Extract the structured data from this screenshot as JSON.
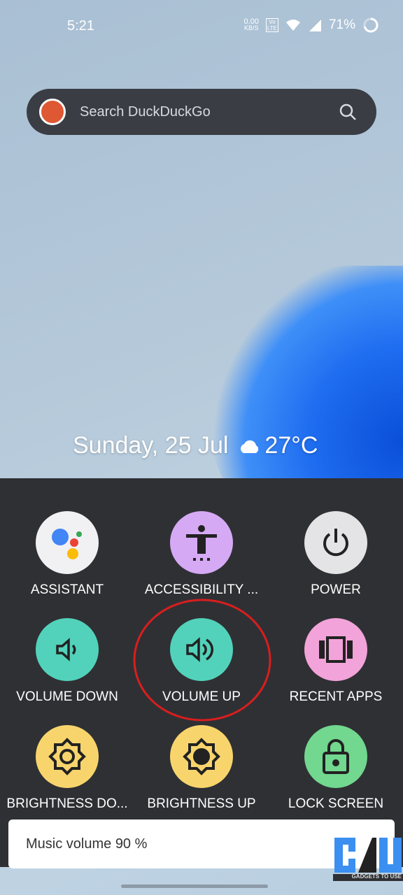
{
  "status": {
    "time": "5:21",
    "net_speed": "0.00",
    "net_unit": "KB/S",
    "volte": "Vo LTE",
    "battery": "71%"
  },
  "search": {
    "placeholder": "Search DuckDuckGo"
  },
  "date_widget": {
    "date": "Sunday, 25 Jul",
    "weather_icon": "cloud-icon",
    "temp": "27°C"
  },
  "menu": {
    "items": [
      {
        "label": "ASSISTANT",
        "icon": "assistant-icon",
        "color": "#f1f1f3"
      },
      {
        "label": "ACCESSIBILITY ...",
        "icon": "accessibility-icon",
        "color": "#d6a9f4"
      },
      {
        "label": "POWER",
        "icon": "power-icon",
        "color": "#e4e4e7"
      },
      {
        "label": "VOLUME DOWN",
        "icon": "volume-down-icon",
        "color": "#52d2ba"
      },
      {
        "label": "VOLUME UP",
        "icon": "volume-up-icon",
        "color": "#52d2ba"
      },
      {
        "label": "RECENT APPS",
        "icon": "recent-apps-icon",
        "color": "#f2a3d9"
      },
      {
        "label": "BRIGHTNESS DO...",
        "icon": "brightness-down-icon",
        "color": "#f8d56c"
      },
      {
        "label": "BRIGHTNESS UP",
        "icon": "brightness-up-icon",
        "color": "#f8d56c"
      },
      {
        "label": "LOCK SCREEN",
        "icon": "lock-icon",
        "color": "#72d78f"
      }
    ]
  },
  "toast": {
    "text": "Music volume 90 %",
    "volume_percent": 90
  },
  "watermark": {
    "text": "GADGETS TO USE"
  }
}
